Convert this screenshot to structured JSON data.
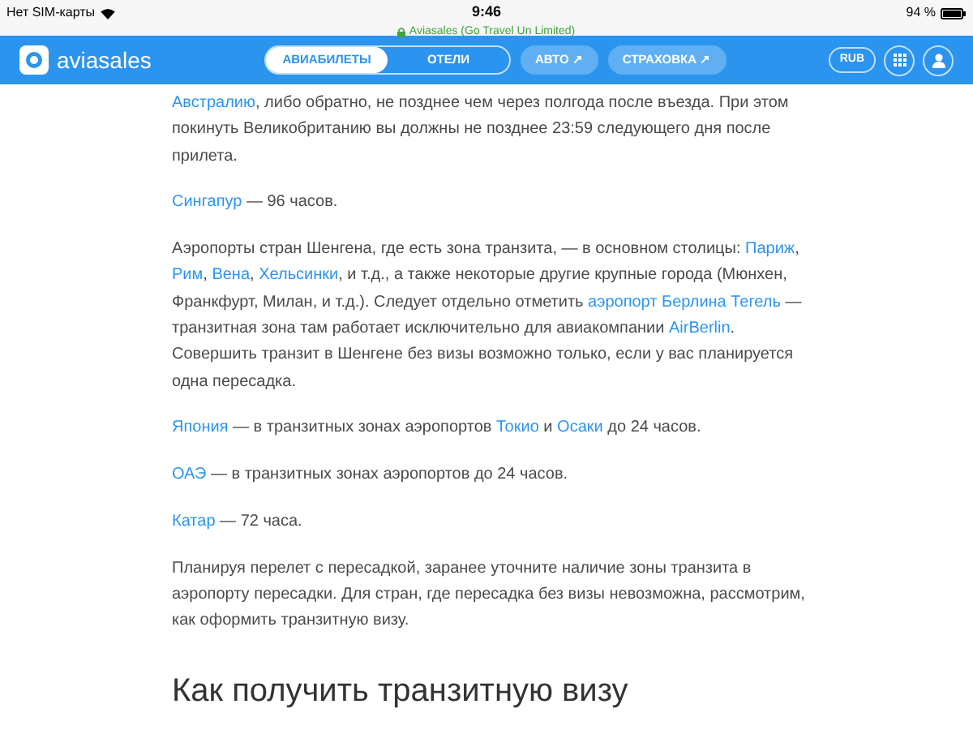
{
  "status_bar": {
    "carrier": "Нет SIM-карты",
    "time": "9:46",
    "site": "Aviasales (Go Travel Un Limited)",
    "battery": "94 %"
  },
  "header": {
    "logo": "aviasales",
    "tabs": [
      {
        "label": "АВИАБИЛЕТЫ",
        "selected": true
      },
      {
        "label": "ОТЕЛИ",
        "selected": false
      }
    ],
    "links": [
      {
        "label": "АВТО ↗"
      },
      {
        "label": "СТРАХОВКА ↗"
      }
    ],
    "currency": "RUB"
  },
  "article": {
    "paragraphs": [
      {
        "segments": [
          {
            "text": "Австралию",
            "link": true
          },
          {
            "text": ", либо обратно, не позднее чем через полгода после въезда. При этом покинуть Великобританию вы должны не позднее 23:59 следующего дня после прилета.",
            "link": false
          }
        ]
      },
      {
        "segments": [
          {
            "text": "Сингапур",
            "link": true
          },
          {
            "text": " — 96 часов.",
            "link": false
          }
        ]
      },
      {
        "segments": [
          {
            "text": "Аэропорты стран Шенгена, где есть зона транзита, — в основном столицы: ",
            "link": false
          },
          {
            "text": "Париж",
            "link": true
          },
          {
            "text": ", ",
            "link": false
          },
          {
            "text": "Рим",
            "link": true
          },
          {
            "text": ", ",
            "link": false
          },
          {
            "text": "Вена",
            "link": true
          },
          {
            "text": ", ",
            "link": false
          },
          {
            "text": "Хельсинки",
            "link": true
          },
          {
            "text": ", и т.д., а также некоторые другие крупные города (Мюнхен, Франкфурт, Милан, и т.д.). Следует отдельно отметить ",
            "link": false
          },
          {
            "text": "аэропорт Берлина Тегель",
            "link": true
          },
          {
            "text": " — транзитная зона там работает исключительно для авиакомпании ",
            "link": false
          },
          {
            "text": "AirBerlin",
            "link": true
          },
          {
            "text": ". Совершить транзит в Шенгене без визы возможно только, если у вас планируется одна пересадка.",
            "link": false
          }
        ]
      },
      {
        "segments": [
          {
            "text": "Япония",
            "link": true
          },
          {
            "text": " — в транзитных зонах аэропортов ",
            "link": false
          },
          {
            "text": "Токио",
            "link": true
          },
          {
            "text": " и ",
            "link": false
          },
          {
            "text": "Осаки",
            "link": true
          },
          {
            "text": " до 24 часов.",
            "link": false
          }
        ]
      },
      {
        "segments": [
          {
            "text": "ОАЭ",
            "link": true
          },
          {
            "text": " — в транзитных зонах аэропортов до 24 часов.",
            "link": false
          }
        ]
      },
      {
        "segments": [
          {
            "text": "Катар",
            "link": true
          },
          {
            "text": " — 72 часа.",
            "link": false
          }
        ]
      },
      {
        "segments": [
          {
            "text": "Планируя перелет с пересадкой, заранее уточните наличие зоны транзита в аэропорту пересадки. Для стран, где пересадка без визы невозможна, рассмотрим, как оформить транзитную визу.",
            "link": false
          }
        ]
      }
    ],
    "heading": "Как получить транзитную визу"
  }
}
